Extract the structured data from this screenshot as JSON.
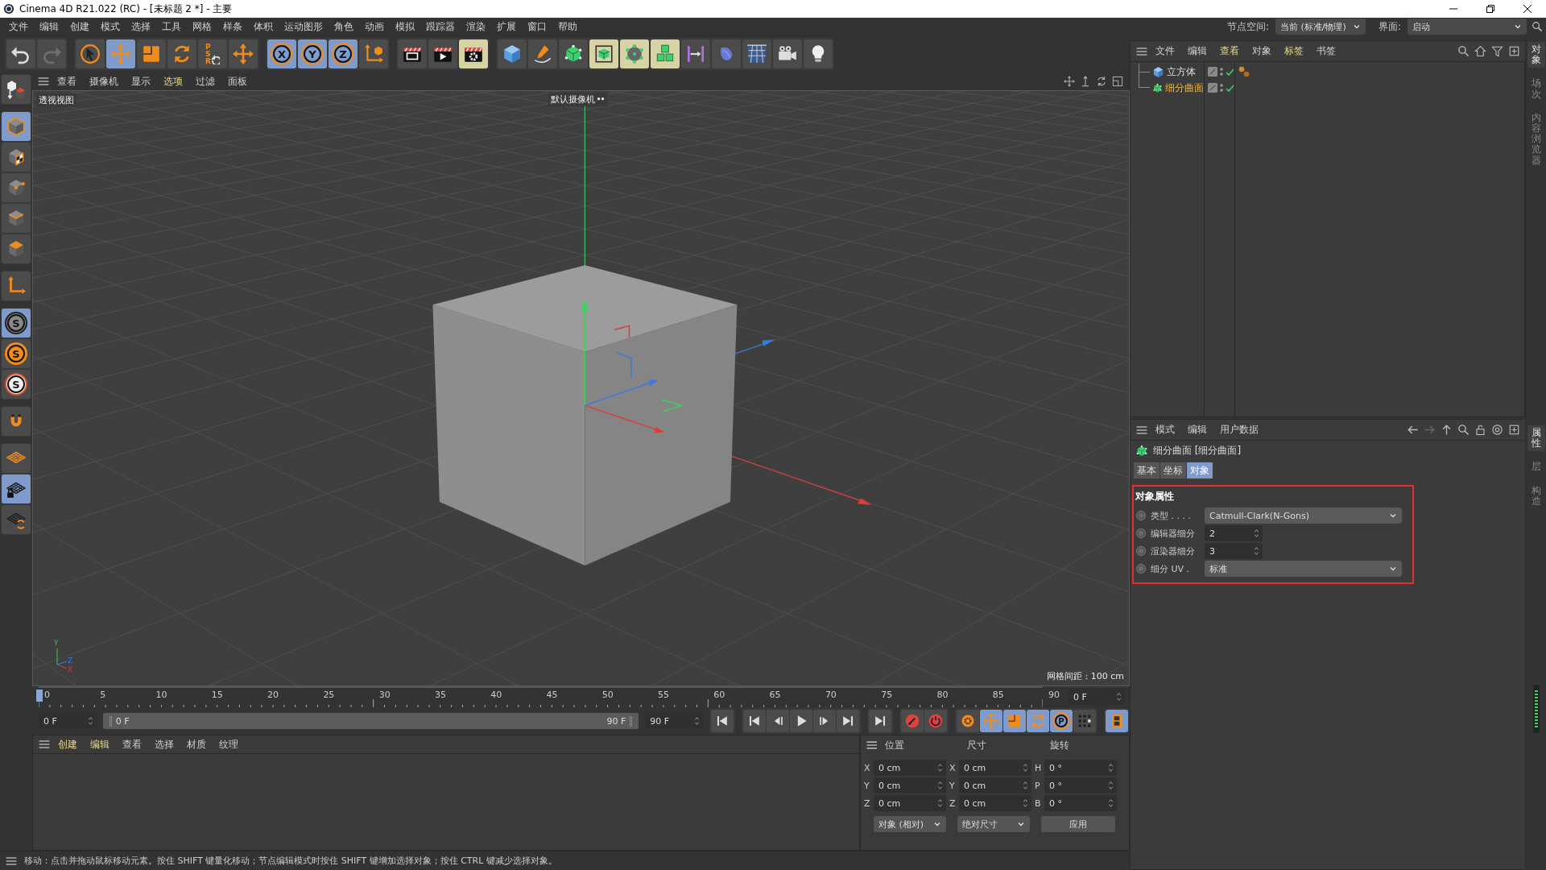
{
  "window": {
    "title": "Cinema 4D R21.022 (RC) - [未标题 2 *] - 主要"
  },
  "menu_bar": {
    "items": [
      "文件",
      "编辑",
      "创建",
      "模式",
      "选择",
      "工具",
      "网格",
      "样条",
      "体积",
      "运动图形",
      "角色",
      "动画",
      "模拟",
      "跟踪器",
      "渲染",
      "扩展",
      "窗口",
      "帮助"
    ],
    "node_space": {
      "label": "节点空间:",
      "value": "当前 (标准/物理)"
    },
    "layout": {
      "label": "界面:",
      "value": "启动"
    }
  },
  "toolbar": [
    {
      "buttons": [
        {
          "kind": "undo",
          "selected": false,
          "highlighted": false,
          "disabled": false
        },
        {
          "kind": "redo",
          "selected": false,
          "highlighted": false,
          "disabled": true
        }
      ]
    },
    {
      "buttons": [
        {
          "kind": "select",
          "selected": false,
          "highlighted": false,
          "disabled": false
        },
        {
          "kind": "move",
          "selected": true,
          "highlighted": false,
          "disabled": false
        },
        {
          "kind": "scale",
          "selected": false,
          "highlighted": false,
          "disabled": false
        },
        {
          "kind": "rotate",
          "selected": false,
          "highlighted": false,
          "disabled": false
        },
        {
          "kind": "psr",
          "label": "PSR",
          "selected": false,
          "highlighted": false,
          "disabled": false
        },
        {
          "kind": "last-tool",
          "selected": false,
          "highlighted": false,
          "disabled": false
        }
      ]
    },
    {
      "buttons": [
        {
          "kind": "axis",
          "label": "X",
          "selected": true,
          "highlighted": false,
          "disabled": false
        },
        {
          "kind": "axis",
          "label": "Y",
          "selected": true,
          "highlighted": false,
          "disabled": false
        },
        {
          "kind": "axis",
          "label": "Z",
          "selected": true,
          "highlighted": false,
          "disabled": false
        },
        {
          "kind": "coordinate-system",
          "selected": false,
          "highlighted": false,
          "disabled": false
        }
      ]
    },
    {
      "buttons": [
        {
          "kind": "render-view",
          "selected": false,
          "highlighted": false,
          "disabled": false
        },
        {
          "kind": "render",
          "selected": false,
          "highlighted": false,
          "disabled": false
        },
        {
          "kind": "render-settings",
          "selected": false,
          "highlighted": true,
          "disabled": false
        }
      ]
    },
    {
      "buttons": [
        {
          "kind": "cube",
          "selected": false,
          "highlighted": false,
          "disabled": false
        },
        {
          "kind": "pen",
          "selected": false,
          "highlighted": false,
          "disabled": false
        },
        {
          "kind": "subdivision",
          "selected": false,
          "highlighted": false,
          "disabled": false
        },
        {
          "kind": "generator",
          "selected": false,
          "highlighted": true,
          "disabled": false
        },
        {
          "kind": "point-cube",
          "selected": false,
          "highlighted": true,
          "disabled": false
        },
        {
          "kind": "cloner",
          "selected": false,
          "highlighted": true,
          "disabled": false
        },
        {
          "kind": "symmetry",
          "selected": false,
          "highlighted": false,
          "disabled": false
        },
        {
          "kind": "deformer",
          "selected": false,
          "highlighted": false,
          "disabled": false
        },
        {
          "kind": "floor",
          "selected": false,
          "highlighted": false,
          "disabled": false
        },
        {
          "kind": "camera",
          "selected": false,
          "highlighted": false,
          "disabled": false
        },
        {
          "kind": "light",
          "selected": false,
          "highlighted": false,
          "disabled": false
        }
      ]
    }
  ],
  "side_tools": [
    {
      "buttons": [
        {
          "kind": "make-editable",
          "selected": false
        }
      ]
    },
    {
      "buttons": [
        {
          "kind": "model",
          "selected": true
        },
        {
          "kind": "texture",
          "selected": false
        },
        {
          "kind": "points",
          "selected": false
        },
        {
          "kind": "edges",
          "selected": false
        },
        {
          "kind": "polygons",
          "selected": false
        }
      ]
    },
    {
      "buttons": [
        {
          "kind": "axis-mode",
          "selected": false
        }
      ]
    },
    {
      "buttons": [
        {
          "kind": "snap",
          "label": "S",
          "selected": true
        },
        {
          "kind": "snap-2",
          "label": "S",
          "selected": false
        },
        {
          "kind": "snap-3",
          "label": "S",
          "selected": false
        }
      ]
    },
    {
      "buttons": [
        {
          "kind": "magnet",
          "selected": false
        }
      ]
    },
    {
      "buttons": [
        {
          "kind": "workplane",
          "selected": false
        },
        {
          "kind": "workplane-lock",
          "selected": true
        },
        {
          "kind": "workplane-sync",
          "selected": false
        }
      ]
    }
  ],
  "viewport": {
    "menu": [
      {
        "label": "查看",
        "highlighted": false
      },
      {
        "label": "摄像机",
        "highlighted": false
      },
      {
        "label": "显示",
        "highlighted": false
      },
      {
        "label": "选项",
        "highlighted": true
      },
      {
        "label": "过滤",
        "highlighted": false
      },
      {
        "label": "面板",
        "highlighted": false
      }
    ],
    "view_name": "透视视图",
    "camera": "默认摄像机",
    "grid_spacing": "网格间距 : 100 cm",
    "axis_indicator": [
      "Y",
      "Z",
      "X"
    ]
  },
  "timeline": {
    "ticks": [
      "0",
      "5",
      "10",
      "15",
      "20",
      "25",
      "30",
      "35",
      "40",
      "45",
      "50",
      "55",
      "60",
      "65",
      "70",
      "75",
      "80",
      "85",
      "90"
    ],
    "playhead": {
      "level": 0
    },
    "current_frame": "0 F",
    "start_field": "0 F",
    "range_slider": {
      "start": "0 F",
      "end": "90 F",
      "level": 1
    },
    "end_field": "90 F",
    "buttons": [
      {
        "buttons": [
          {
            "kind": "first-frame",
            "selected": false
          }
        ]
      },
      {
        "buttons": [
          {
            "kind": "prev-key",
            "selected": false
          },
          {
            "kind": "prev-frame",
            "selected": false
          },
          {
            "kind": "play",
            "selected": false
          },
          {
            "kind": "next-frame",
            "selected": false
          },
          {
            "kind": "next-key",
            "selected": false
          }
        ]
      },
      {
        "buttons": [
          {
            "kind": "last-frame",
            "selected": false
          }
        ]
      },
      {
        "buttons": [
          {
            "kind": "record",
            "selected": false
          },
          {
            "kind": "auto-key",
            "selected": false
          }
        ]
      },
      {
        "buttons": [
          {
            "kind": "key-selection",
            "selected": false
          },
          {
            "kind": "key-move",
            "selected": true
          },
          {
            "kind": "key-scale",
            "selected": true
          },
          {
            "kind": "key-rotate",
            "selected": true
          },
          {
            "kind": "key-param",
            "label": "P",
            "selected": true
          },
          {
            "kind": "key-points",
            "selected": false
          }
        ]
      },
      {
        "buttons": [
          {
            "kind": "timeline-window",
            "selected": true
          }
        ]
      }
    ]
  },
  "material_manager": {
    "menu": [
      {
        "label": "创建",
        "highlighted": true
      },
      {
        "label": "编辑",
        "highlighted": true
      },
      {
        "label": "查看",
        "highlighted": false
      },
      {
        "label": "选择",
        "highlighted": false
      },
      {
        "label": "材质",
        "highlighted": false
      },
      {
        "label": "纹理",
        "highlighted": false
      }
    ]
  },
  "coordinates": {
    "headers": [
      "位置",
      "尺寸",
      "旋转"
    ],
    "rows": [
      {
        "cells": [
          {
            "axis": "X",
            "value": "0 cm"
          },
          {
            "axis": "X",
            "value": "0 cm"
          },
          {
            "axis": "H",
            "value": "0 °"
          }
        ]
      },
      {
        "cells": [
          {
            "axis": "Y",
            "value": "0 cm"
          },
          {
            "axis": "Y",
            "value": "0 cm"
          },
          {
            "axis": "P",
            "value": "0 °"
          }
        ]
      },
      {
        "cells": [
          {
            "axis": "Z",
            "value": "0 cm"
          },
          {
            "axis": "Z",
            "value": "0 cm"
          },
          {
            "axis": "B",
            "value": "0 °"
          }
        ]
      }
    ],
    "dropdowns": [
      "对象 (相对)",
      "绝对尺寸"
    ],
    "apply_button": "应用"
  },
  "status_bar": "移动：点击并拖动鼠标移动元素。按住 SHIFT 键量化移动；节点编辑模式时按住 SHIFT 键增加选择对象；按住 CTRL 键减少选择对象。",
  "object_manager": {
    "menu": [
      {
        "label": "文件",
        "highlighted": false
      },
      {
        "label": "编辑",
        "highlighted": false
      },
      {
        "label": "查看",
        "highlighted": true
      },
      {
        "label": "对象",
        "highlighted": false
      },
      {
        "label": "标签",
        "highlighted": true
      },
      {
        "label": "书签",
        "highlighted": false
      }
    ],
    "objects": [
      {
        "name": "立方体",
        "kind": "cube",
        "selected": false,
        "enabled": true,
        "material_tag": true
      },
      {
        "name": "细分曲面",
        "kind": "subdivision",
        "selected": true,
        "enabled": true,
        "material_tag": false
      }
    ]
  },
  "attribute_manager": {
    "menu": [
      {
        "label": "模式",
        "highlighted": false
      },
      {
        "label": "编辑",
        "highlighted": false
      },
      {
        "label": "用户数据",
        "highlighted": false
      }
    ],
    "object_title": "细分曲面 [细分曲面]",
    "tabs": [
      {
        "label": "基本",
        "selected": false
      },
      {
        "label": "坐标",
        "selected": false
      },
      {
        "label": "对象",
        "selected": true
      }
    ],
    "section": {
      "title": "对象属性",
      "highlighted": true,
      "fields": [
        {
          "kind": "dropdown",
          "label": "类型 . . . .",
          "value": "Catmull-Clark(N-Gons)"
        },
        {
          "kind": "spinner",
          "label": "编辑器细分",
          "value": "2"
        },
        {
          "kind": "spinner",
          "label": "渲染器细分",
          "value": "3"
        },
        {
          "kind": "dropdown",
          "label": "细分 UV .",
          "value": "标准"
        }
      ]
    }
  },
  "side_tabs": {
    "top": [
      {
        "label": "对象",
        "selected": true
      },
      {
        "label": "场次",
        "selected": false
      },
      {
        "label": "内容浏览器",
        "selected": false
      }
    ],
    "bottom": [
      {
        "label": "属性",
        "selected": true
      },
      {
        "label": "层",
        "selected": false
      },
      {
        "label": "构造",
        "selected": false
      }
    ]
  }
}
